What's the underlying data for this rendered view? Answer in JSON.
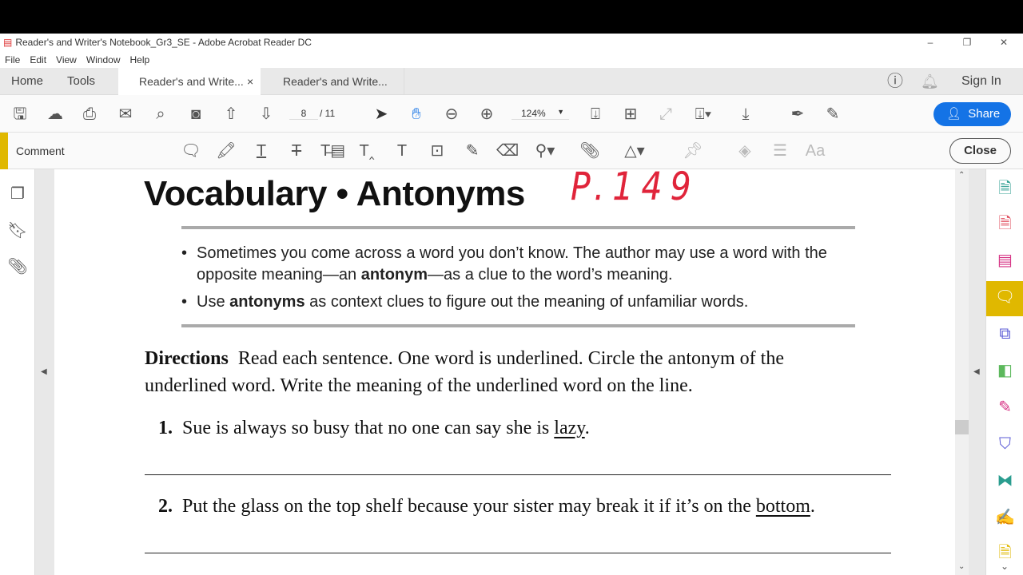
{
  "window": {
    "title": "Reader's and Writer's Notebook_Gr3_SE - Adobe Acrobat Reader DC",
    "minimize": "–",
    "restore": "❐",
    "close": "✕"
  },
  "menu": [
    "File",
    "Edit",
    "View",
    "Window",
    "Help"
  ],
  "tabs": {
    "home": "Home",
    "tools": "Tools",
    "doc_tabs": [
      {
        "label": "Reader's and Write...",
        "close": "×"
      },
      {
        "label": "Reader's and Write..."
      }
    ],
    "sign_in": "Sign In"
  },
  "toolbar": {
    "page_current": "8",
    "page_total": "/ 11",
    "zoom": "124%",
    "share": "Share"
  },
  "comment_bar": {
    "label": "Comment",
    "text_style": "Aa",
    "close": "Close"
  },
  "document": {
    "title": "Vocabulary • Antonyms",
    "handwriting": "P.149",
    "bullets": [
      {
        "pre": "Sometimes you come across a word you don’t know. The author may use a word with the opposite meaning—an ",
        "bold": "antonym",
        "post": "—as a clue to the word’s meaning."
      },
      {
        "pre": "Use ",
        "bold": "antonyms",
        "post": " as context clues to figure out the meaning of unfamiliar words."
      }
    ],
    "directions_label": "Directions",
    "directions_text": "Read each sentence. One word is underlined. Circle the antonym of the underlined word. Write the meaning of the underlined word on the line.",
    "items": [
      {
        "num": "1.",
        "pre": "Sue is always so busy that no one can say she is ",
        "underlined": "lazy",
        "post": "."
      },
      {
        "num": "2.",
        "pre": "Put the glass on the top shelf because your sister may break it if it’s on the ",
        "underlined": "bottom",
        "post": "."
      }
    ]
  },
  "colors": {
    "accent": "#1473e6",
    "comment_yellow": "#e0b800",
    "handwriting": "#e0243a"
  }
}
